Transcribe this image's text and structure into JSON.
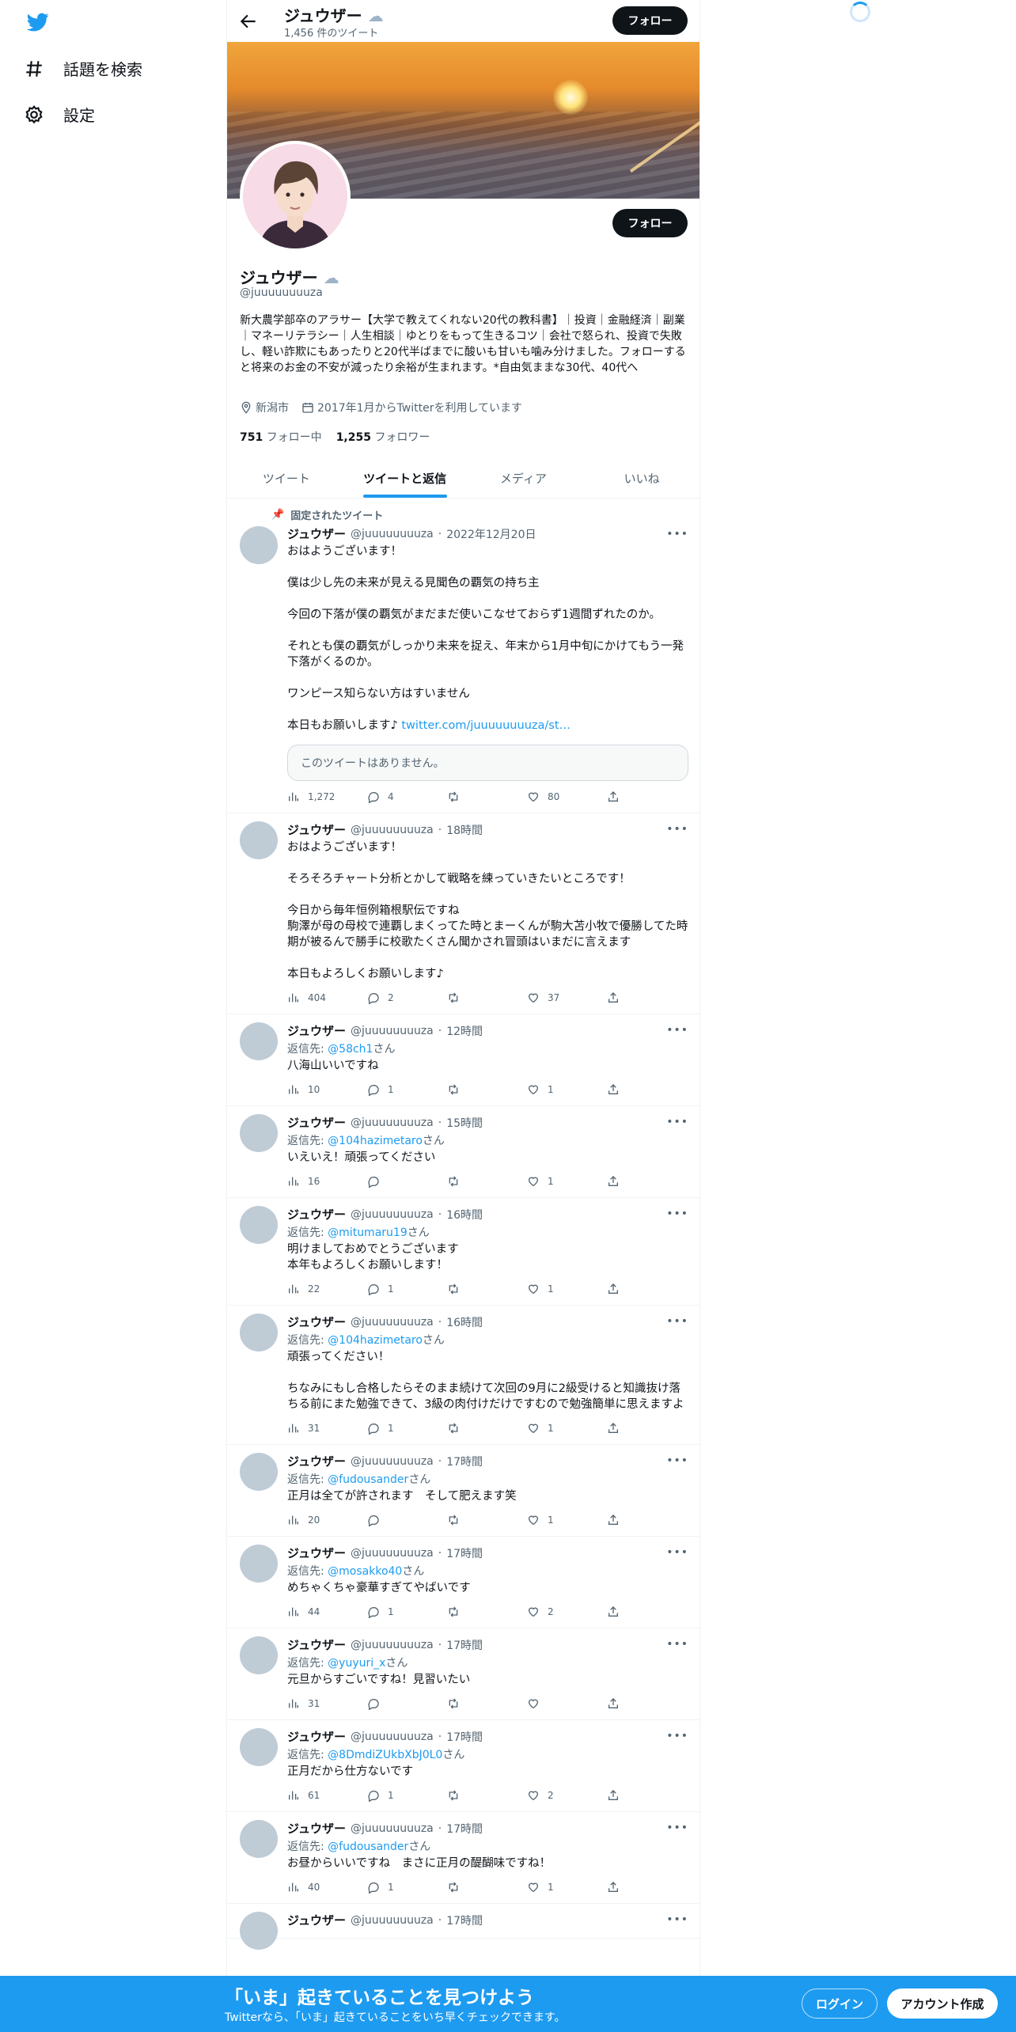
{
  "nav": {
    "explore": "話題を検索",
    "settings": "設定"
  },
  "header": {
    "name": "ジュウザー",
    "tweet_count": "1,456 件のツイート",
    "follow": "フォロー"
  },
  "profile": {
    "name": "ジュウザー",
    "handle": "@juuuuuuuuza",
    "follow": "フォロー",
    "bio": "新大農学部卒のアラサー【大学で教えてくれない20代の教科書】｜投資｜金融経済｜副業｜マネーリテラシー｜人生相談｜ゆとりをもって生きるコツ｜会社で怒られ、投資で失敗し、軽い詐欺にもあったりと20代半ばまでに酸いも甘いも噛み分けました。フォローすると将来のお金の不安が減ったり余裕が生まれます。*自由気ままな30代、40代へ",
    "location": "新潟市",
    "joined": "2017年1月からTwitterを利用しています",
    "following_count": "751",
    "following_label": "フォロー中",
    "followers_count": "1,255",
    "followers_label": "フォロワー"
  },
  "tabs": [
    "ツイート",
    "ツイートと返信",
    "メディア",
    "いいね"
  ],
  "pinned_label": "固定されたツイート",
  "tweets": [
    {
      "name": "ジュウザー",
      "handle": "@juuuuuuuuza",
      "time": "2022年12月20日",
      "reply_to": "",
      "text": "おはようございます！\n\n僕は少し先の未来が見える見聞色の覇気の持ち主\n\n今回の下落が僕の覇気がまだまだ使いこなせておらず1週間ずれたのか。\n\nそれとも僕の覇気がしっかり未来を捉え、年末から1月中旬にかけてもう一発下落がくるのか。\n\nワンピース知らない方はすいません\n\n本日もお願いします♪ ",
      "link": "twitter.com/juuuuuuuuza/st…",
      "quote": "このツイートはありません。",
      "views": "1,272",
      "replies": "4",
      "retweets": "",
      "likes": "80"
    },
    {
      "name": "ジュウザー",
      "handle": "@juuuuuuuuza",
      "time": "18時間",
      "reply_to": "",
      "text": "おはようございます！\n\nそろそろチャート分析とかして戦略を練っていきたいところです！\n\n今日から毎年恒例箱根駅伝ですね\n駒澤が母の母校で連覇しまくってた時とまーくんが駒大苫小牧で優勝してた時期が被るんで勝手に校歌たくさん聞かされ冒頭はいまだに言えます\n\n本日もよろしくお願いします♪",
      "views": "404",
      "replies": "2",
      "retweets": "",
      "likes": "37"
    },
    {
      "name": "ジュウザー",
      "handle": "@juuuuuuuuza",
      "time": "12時間",
      "reply_to": "@58ch1",
      "text": "八海山いいですね",
      "views": "10",
      "replies": "1",
      "retweets": "",
      "likes": "1"
    },
    {
      "name": "ジュウザー",
      "handle": "@juuuuuuuuza",
      "time": "15時間",
      "reply_to": "@104hazimetaro",
      "text": "いえいえ！頑張ってください",
      "views": "16",
      "replies": "",
      "retweets": "",
      "likes": "1"
    },
    {
      "name": "ジュウザー",
      "handle": "@juuuuuuuuza",
      "time": "16時間",
      "reply_to": "@mitumaru19",
      "text": "明けましておめでとうございます\n本年もよろしくお願いします！",
      "views": "22",
      "replies": "1",
      "retweets": "",
      "likes": "1"
    },
    {
      "name": "ジュウザー",
      "handle": "@juuuuuuuuza",
      "time": "16時間",
      "reply_to": "@104hazimetaro",
      "text": "頑張ってください！\n\nちなみにもし合格したらそのまま続けて次回の9月に2級受けると知識抜け落ちる前にまた勉強できて、3級の肉付けだけですむので勉強簡単に思えますよ",
      "views": "31",
      "replies": "1",
      "retweets": "",
      "likes": "1"
    },
    {
      "name": "ジュウザー",
      "handle": "@juuuuuuuuza",
      "time": "17時間",
      "reply_to": "@fudousander",
      "text": "正月は全てが許されます　そして肥えます笑",
      "views": "20",
      "replies": "",
      "retweets": "",
      "likes": "1"
    },
    {
      "name": "ジュウザー",
      "handle": "@juuuuuuuuza",
      "time": "17時間",
      "reply_to": "@mosakko40",
      "text": "めちゃくちゃ豪華すぎてやばいです",
      "views": "44",
      "replies": "1",
      "retweets": "",
      "likes": "2"
    },
    {
      "name": "ジュウザー",
      "handle": "@juuuuuuuuza",
      "time": "17時間",
      "reply_to": "@yuyuri_x",
      "text": "元旦からすごいですね！見習いたい",
      "views": "31",
      "replies": "",
      "retweets": "",
      "likes": ""
    },
    {
      "name": "ジュウザー",
      "handle": "@juuuuuuuuza",
      "time": "17時間",
      "reply_to": "@8DmdiZUkbXbJ0L0",
      "text": "正月だから仕方ないです",
      "views": "61",
      "replies": "1",
      "retweets": "",
      "likes": "2"
    },
    {
      "name": "ジュウザー",
      "handle": "@juuuuuuuuza",
      "time": "17時間",
      "reply_to": "@fudousander",
      "text": "お昼からいいですね　まさに正月の醍醐味ですね！",
      "views": "40",
      "replies": "1",
      "retweets": "",
      "likes": "1"
    },
    {
      "name": "ジュウザー",
      "handle": "@juuuuuuuuza",
      "time": "17時間",
      "reply_to": "",
      "text": "",
      "views": "",
      "replies": "",
      "retweets": "",
      "likes": ""
    }
  ],
  "reply_prefix": "返信先: ",
  "reply_suffix": "さん",
  "footer": {
    "title": "「いま」起きていることを見つけよう",
    "subtitle": "Twitterなら、「いま」起きていることをいち早くチェックできます。",
    "login": "ログイン",
    "signup": "アカウント作成"
  }
}
